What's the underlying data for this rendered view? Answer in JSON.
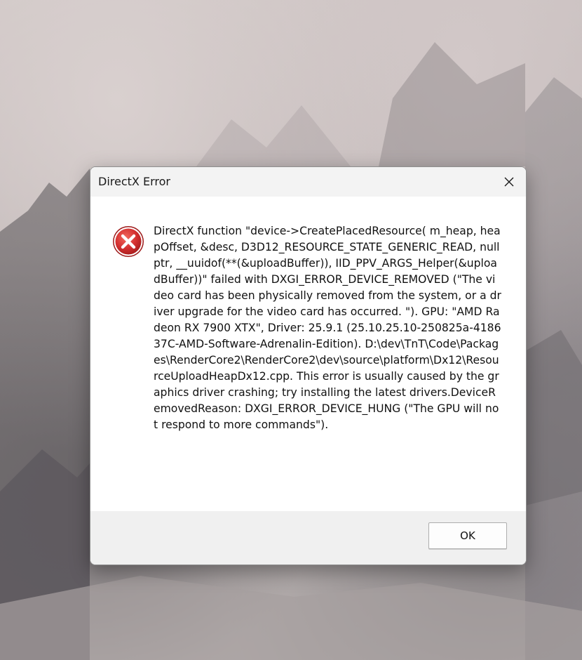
{
  "desktop": {
    "wallpaper": "misty-mountain-landscape"
  },
  "dialog": {
    "title": "DirectX Error",
    "close_icon": "close-icon",
    "status_icon": "error-icon",
    "message": "DirectX function \"device->CreatePlacedResource( m_heap, heapOffset, &desc, D3D12_RESOURCE_STATE_GENERIC_READ, nullptr, __uuidof(**(&uploadBuffer)), IID_PPV_ARGS_Helper(&uploadBuffer))\" failed with DXGI_ERROR_DEVICE_REMOVED (\"The video card has been physically removed from the system, or a driver upgrade for the video card has occurred. \"). GPU: \"AMD Radeon RX 7900 XTX\", Driver: 25.9.1 (25.10.25.10-250825a-418637C-AMD-Software-Adrenalin-Edition). D:\\dev\\TnT\\Code\\Packages\\RenderCore2\\RenderCore2\\dev\\source\\platform\\Dx12\\ResourceUploadHeapDx12.cpp. This error is usually caused by the graphics driver crashing; try installing the latest drivers.DeviceRemovedReason: DXGI_ERROR_DEVICE_HUNG (\"The GPU will not respond to more commands\").",
    "ok_label": "OK"
  },
  "colors": {
    "error_red": "#d32f2f",
    "titlebar_bg": "#f3f3f3",
    "footer_bg": "#f0f0f0"
  }
}
